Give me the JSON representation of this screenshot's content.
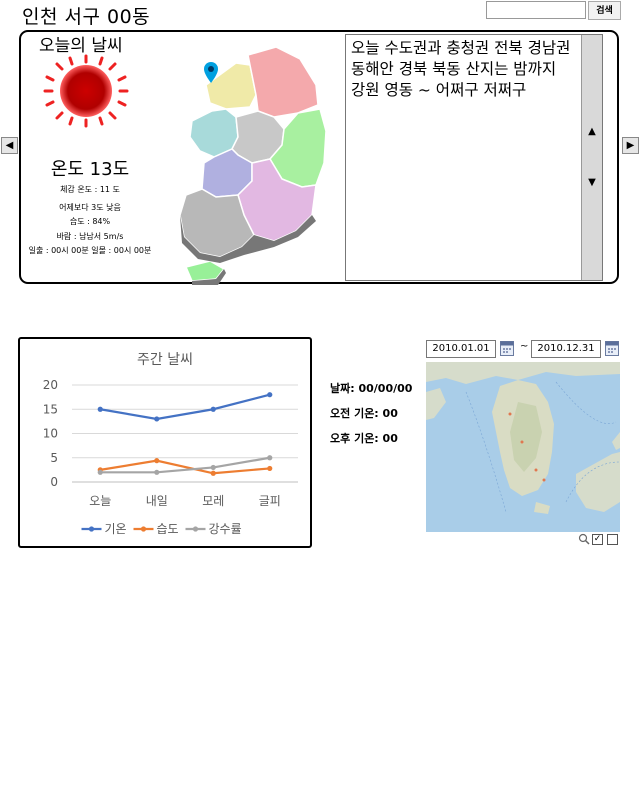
{
  "header": {
    "title": "인천 서구 00동",
    "search_value": "",
    "search_button": "검색"
  },
  "nav": {
    "prev": "◀",
    "next": "▶"
  },
  "today": {
    "title": "오늘의 날씨",
    "temperature": "온도 13도",
    "feels_like": "체감 온도 : 11 도",
    "compare": "어제보다 3도 낮음",
    "humidity": "습도 : 84%",
    "wind": "바람 : 남남서 5m/s",
    "sun": "일출 : 00시 00분 일몰 : 00시 00분",
    "sun_icon": "sun-icon",
    "map_icon": "location-pin-icon"
  },
  "forecast": {
    "text": "오늘 수도권과 충청권 전북 경남권 동해안 경북 북동 산지는 밤까지 강원 영동 ~ 어쩌구 저쩌구",
    "scroll_up": "▲",
    "scroll_down": "▼"
  },
  "chart_data": {
    "type": "line",
    "title": "주간 날씨",
    "categories": [
      "오늘",
      "내일",
      "모레",
      "글피"
    ],
    "ylim": [
      0,
      20
    ],
    "yticks": [
      0,
      5,
      10,
      15,
      20
    ],
    "grid": true,
    "legend": "bottom",
    "series": [
      {
        "name": "기온",
        "color": "#4472c4",
        "values": [
          15,
          13,
          15,
          18
        ]
      },
      {
        "name": "습도",
        "color": "#ed7d31",
        "values": [
          2.5,
          4.4,
          1.8,
          2.8
        ]
      },
      {
        "name": "강수률",
        "color": "#a5a5a5",
        "values": [
          2,
          2,
          3,
          5
        ]
      }
    ]
  },
  "info": {
    "date": "날짜: 00/00/00",
    "am_temp": "오전 기온: 00",
    "pm_temp": "오후 기온: 00"
  },
  "date_range": {
    "start": "2010.01.01",
    "separator": "~",
    "end": "2010.12.31"
  },
  "map_controls": {
    "checked_mark": "✓"
  },
  "colors": {
    "accent": "#4472c4",
    "sun": "#cc0000"
  }
}
